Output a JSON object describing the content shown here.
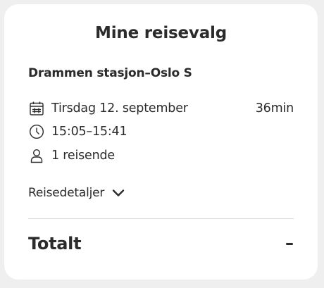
{
  "card": {
    "title": "Mine reisevalg",
    "route": "Drammen stasjon–Oslo S",
    "date": {
      "icon": "calendar-icon",
      "text": "Tirsdag 12. september"
    },
    "duration": "36min",
    "time": {
      "icon": "clock-icon",
      "text": "15:05–15:41"
    },
    "travelers": {
      "icon": "person-icon",
      "text": "1 reisende"
    },
    "details": {
      "label": "Reisedetaljer",
      "icon": "chevron-down-icon"
    },
    "total": {
      "label": "Totalt",
      "value": "–"
    }
  },
  "colors": {
    "background": "#efefef",
    "card": "#ffffff",
    "text": "#2b2b2b",
    "divider": "#d9d9d9"
  }
}
